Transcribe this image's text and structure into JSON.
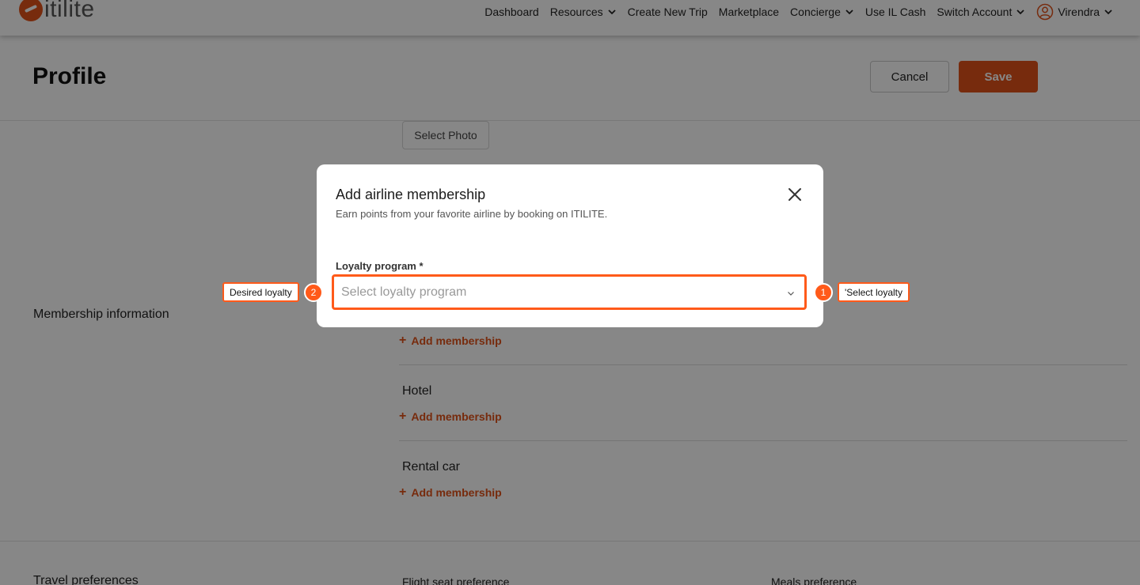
{
  "brand": {
    "logo_text": "itilite",
    "accent_color": "#e0521a",
    "highlight_color": "#ff5a1a"
  },
  "nav": {
    "items": [
      {
        "label": "Dashboard",
        "dropdown": false
      },
      {
        "label": "Resources",
        "dropdown": true
      },
      {
        "label": "Create New Trip",
        "dropdown": false
      },
      {
        "label": "Marketplace",
        "dropdown": false
      },
      {
        "label": "Concierge",
        "dropdown": true
      },
      {
        "label": "Use IL Cash",
        "dropdown": false
      },
      {
        "label": "Switch Account",
        "dropdown": true
      }
    ],
    "user_name": "Virendra"
  },
  "page": {
    "title": "Profile",
    "cancel_label": "Cancel",
    "save_label": "Save",
    "select_photo_label": "Select Photo",
    "membership_section_label": "Membership information",
    "add_membership_label": "Add membership",
    "hotel_heading": "Hotel",
    "rental_car_heading": "Rental car",
    "travel_preferences_label": "Travel preferences",
    "flight_seat_label": "Flight seat preference",
    "meals_label": "Meals preference"
  },
  "modal": {
    "title": "Add airline membership",
    "subtitle": "Earn points from your favorite airline by booking on ITILITE.",
    "field_label": "Loyalty program *",
    "select_placeholder": "Select loyalty program"
  },
  "annotations": [
    {
      "number": "1",
      "text": "'Select loyalty"
    },
    {
      "number": "2",
      "text": "Desired loyalty"
    }
  ]
}
